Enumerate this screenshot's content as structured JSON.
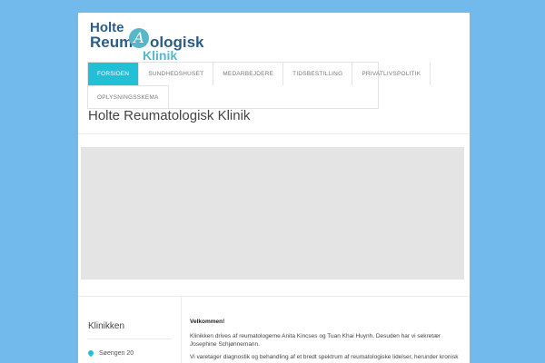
{
  "logo": {
    "line1": "Holte",
    "line2a": "Reum",
    "circle_glyph": "A",
    "line2b": "ologisk",
    "line3": "Klinik"
  },
  "nav": {
    "row1": [
      {
        "label": "FORSIDEN",
        "active": true
      },
      {
        "label": "SUNDHEDSHUSET",
        "active": false
      },
      {
        "label": "MEDARBEJDERE",
        "active": false
      },
      {
        "label": "TIDSBESTILLING",
        "active": false
      },
      {
        "label": "PRIVATLIVSPOLITIK",
        "active": false
      }
    ],
    "row2": [
      {
        "label": "OPLYSNINGSSKEMA",
        "active": false
      }
    ]
  },
  "page_title": "Holte Reumatologisk Klinik",
  "sidebar": {
    "title": "Klinikken",
    "address": "Søengen 20"
  },
  "content": {
    "welcome": "Velkommen!",
    "paragraph1": "Klinikken drives af reumatologerne Anita Kincses og Tuan Khai Huynh. Desuden har vi sekretær Josephine Schjønnemann.",
    "paragraph2": "Vi varetager diagnostik og behandling af et bredt spektrum af reumatologiske lidelser, herunder kronisk"
  },
  "colors": {
    "background": "#72b9ec",
    "accent": "#21c0d6",
    "logo_dark": "#2c5d86"
  },
  "icons": {
    "map_pin": "map-pin-icon"
  }
}
